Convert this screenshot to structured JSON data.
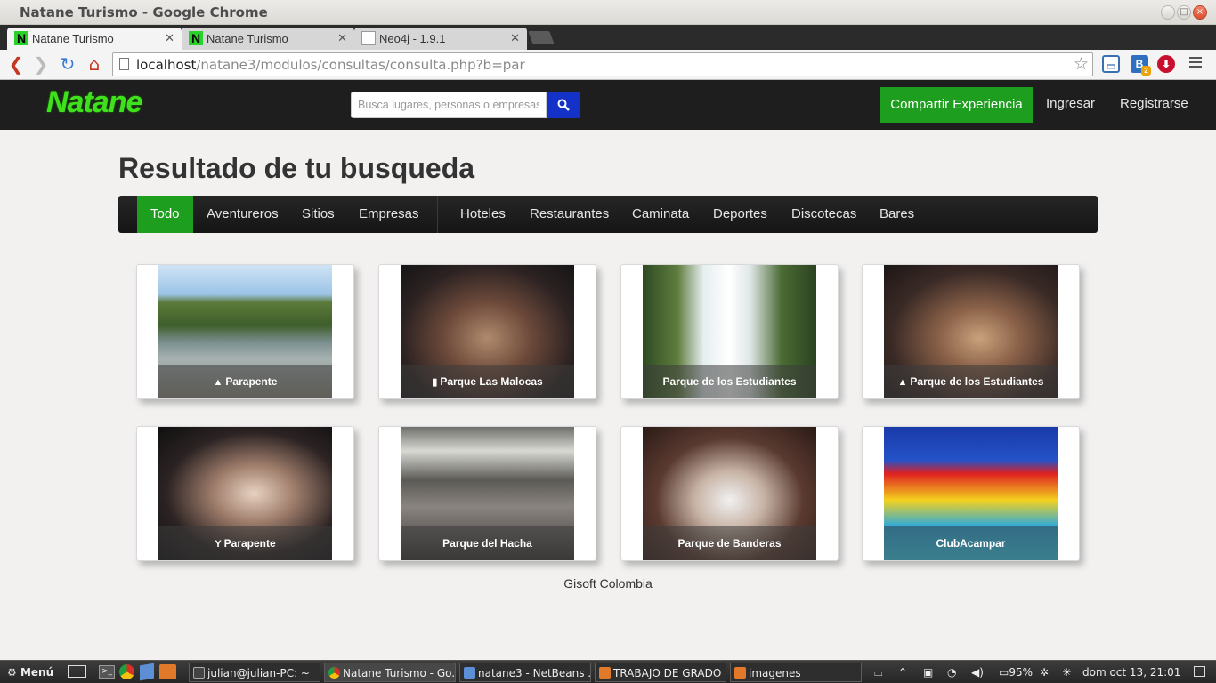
{
  "window": {
    "title": "Natane Turismo - Google Chrome"
  },
  "tabs": [
    {
      "label": "Natane Turismo",
      "fav": "N"
    },
    {
      "label": "Natane Turismo",
      "fav": "N"
    },
    {
      "label": "Neo4j - 1.9.1",
      "fav": ""
    }
  ],
  "browser": {
    "url_host": "localhost",
    "url_path": "/natane3/modulos/consultas/consulta.php?b=par",
    "ext_b_label": "B",
    "ext_b_badge": "2"
  },
  "site": {
    "logo": "Natane",
    "search_placeholder": "Busca lugares, personas o empresas",
    "share_label": "Compartir Experiencia",
    "login_label": "Ingresar",
    "register_label": "Registrarse"
  },
  "content": {
    "title": "Resultado de tu busqueda",
    "filters": [
      "Todo",
      "Aventureros",
      "Sitios",
      "Empresas",
      "Hoteles",
      "Restaurantes",
      "Caminata",
      "Deportes",
      "Discotecas",
      "Bares"
    ],
    "results": [
      {
        "caption": "Parapente",
        "icon": "road-icon",
        "icon_glyph": "▲"
      },
      {
        "caption": "Parque Las Malocas",
        "icon": "briefcase-icon",
        "icon_glyph": "▮"
      },
      {
        "caption": "Parque de los Estudiantes",
        "icon": "",
        "icon_glyph": ""
      },
      {
        "caption": "Parque de los Estudiantes",
        "icon": "road-icon",
        "icon_glyph": "▲"
      },
      {
        "caption": "Parapente",
        "icon": "glass-icon",
        "icon_glyph": "Y"
      },
      {
        "caption": "Parque del Hacha",
        "icon": "",
        "icon_glyph": ""
      },
      {
        "caption": "Parque de Banderas",
        "icon": "",
        "icon_glyph": ""
      },
      {
        "caption": "ClubAcampar",
        "icon": "",
        "icon_glyph": ""
      }
    ],
    "footer": "Gisoft Colombia"
  },
  "taskbar": {
    "menu_label": "Menú",
    "windows": [
      "julian@julian-PC: ~",
      "Natane Turismo - Go...",
      "natane3 - NetBeans ...",
      "TRABAJO DE GRADO",
      "imagenes"
    ],
    "battery": "95%",
    "clock": "dom oct 13, 21:01"
  },
  "colors": {
    "brand_green": "#1e9e1e",
    "logo_green": "#3fe01c",
    "search_blue": "#1532c8",
    "navbar": "#1e1e1e"
  }
}
